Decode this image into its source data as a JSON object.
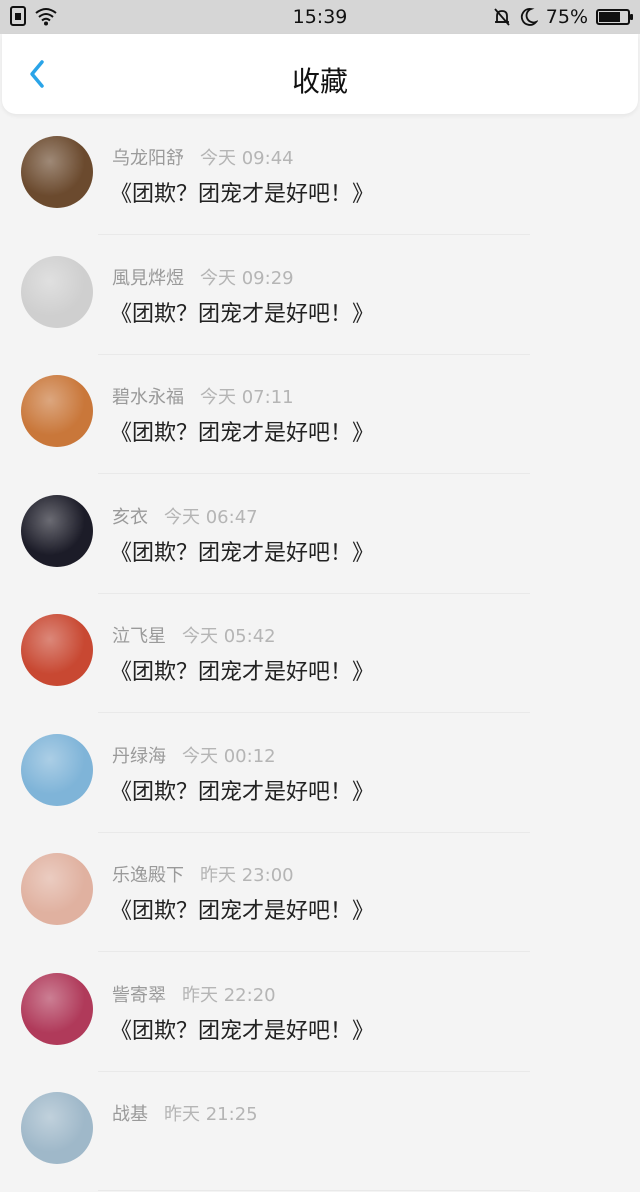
{
  "status_bar": {
    "time": "15:39",
    "battery_text": "75%",
    "battery_level": 0.75,
    "icons_left": [
      "sim-icon",
      "wifi-icon"
    ],
    "icons_right": [
      "mute-bell-icon",
      "moon-icon"
    ]
  },
  "header": {
    "title": "收藏",
    "back_icon": "chevron-left-icon",
    "accent_color": "#2aa4e8"
  },
  "items": [
    {
      "name": "乌龙阳舒",
      "time": "今天 09:44",
      "message": "《团欺？团宠才是好吧！》",
      "avatar_color": "#6b4a2e"
    },
    {
      "name": "風見烨煜",
      "time": "今天 09:29",
      "message": "《团欺？团宠才是好吧！》",
      "avatar_color": "#cfcfcf"
    },
    {
      "name": "碧水永福",
      "time": "今天 07:11",
      "message": "《团欺？团宠才是好吧！》",
      "avatar_color": "#c9773a"
    },
    {
      "name": "亥衣",
      "time": "今天 06:47",
      "message": "《团欺？团宠才是好吧！》",
      "avatar_color": "#1c1c28"
    },
    {
      "name": "泣飞星",
      "time": "今天 05:42",
      "message": "《团欺？团宠才是好吧！》",
      "avatar_color": "#c84832"
    },
    {
      "name": "丹绿海",
      "time": "今天 00:12",
      "message": "《团欺？团宠才是好吧！》",
      "avatar_color": "#7fb4d8"
    },
    {
      "name": "乐逸殿下",
      "time": "昨天 23:00",
      "message": "《团欺？团宠才是好吧！》",
      "avatar_color": "#e0b1a0"
    },
    {
      "name": "訾寄翠",
      "time": "昨天 22:20",
      "message": "《团欺？团宠才是好吧！》",
      "avatar_color": "#b03a5a"
    },
    {
      "name": "战基",
      "time": "昨天 21:25",
      "message": "",
      "avatar_color": "#9fb8c9"
    }
  ]
}
